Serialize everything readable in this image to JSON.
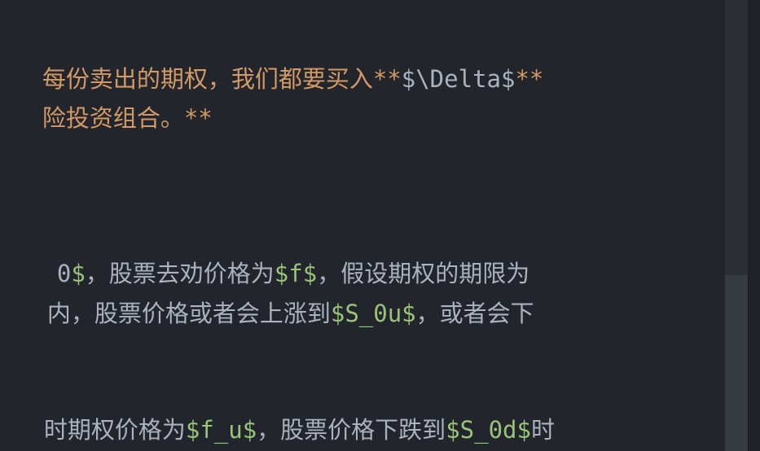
{
  "editor": {
    "lines": [
      {
        "segments": [
          {
            "text": "每份卖出的期权，我们都要买入**",
            "style": "orange"
          },
          {
            "text": "$\\Delta$",
            "style": "slate"
          },
          {
            "text": "**",
            "style": "orange"
          }
        ]
      },
      {
        "segments": [
          {
            "text": "险投资组合。**",
            "style": "orange"
          }
        ]
      },
      {
        "segments": [
          {
            "text": "0",
            "style": "slate"
          },
          {
            "text": "$",
            "style": "green"
          },
          {
            "text": "，股票去劝价格为",
            "style": "slate"
          },
          {
            "text": "$f$",
            "style": "green"
          },
          {
            "text": "，假设期权的期限为",
            "style": "slate"
          }
        ]
      },
      {
        "segments": [
          {
            "text": "内，股票价格或者会上涨到",
            "style": "slate"
          },
          {
            "text": "$S_0u$",
            "style": "green"
          },
          {
            "text": "，或者会下",
            "style": "slate"
          }
        ]
      },
      {
        "segments": [
          {
            "text": "时期权价格为",
            "style": "slate"
          },
          {
            "text": "$f_u$",
            "style": "green"
          },
          {
            "text": "，股票价格下跌到",
            "style": "slate"
          },
          {
            "text": "$S_0d$",
            "style": "green"
          },
          {
            "text": "时",
            "style": "slate"
          }
        ]
      }
    ]
  },
  "colors": {
    "background": "#22252b",
    "bold_text": "#d19a66",
    "math_delimiter": "#98c379",
    "plain_text": "#a9b0bc"
  }
}
